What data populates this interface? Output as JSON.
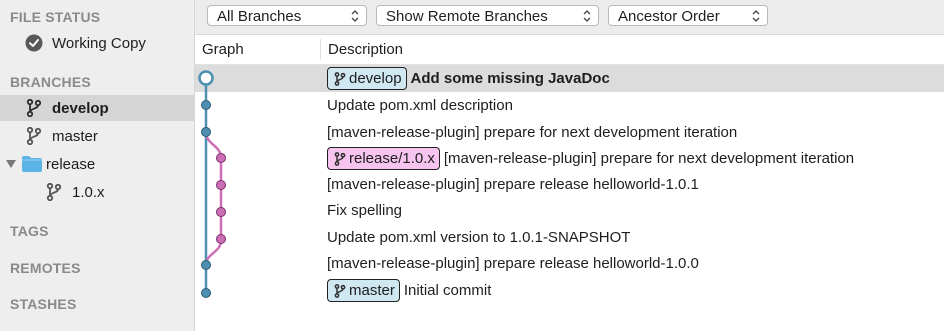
{
  "sidebar": {
    "file_status": "FILE STATUS",
    "working_copy": "Working Copy",
    "branches": "BRANCHES",
    "branch_items": [
      "develop",
      "master"
    ],
    "release_folder": "release",
    "release_child": "1.0.x",
    "tags": "TAGS",
    "remotes": "REMOTES",
    "stashes": "STASHES"
  },
  "toolbar": {
    "branches_filter": "All Branches",
    "remote_filter": "Show Remote Branches",
    "order": "Ancestor Order"
  },
  "table": {
    "col_graph": "Graph",
    "col_desc": "Description",
    "rows": [
      {
        "ref": "develop",
        "desc": "Add some missing JavaDoc"
      },
      {
        "desc": "Update pom.xml description"
      },
      {
        "desc": "[maven-release-plugin] prepare for next development iteration"
      },
      {
        "ref": "release/1.0.x",
        "desc": "[maven-release-plugin] prepare for next development iteration"
      },
      {
        "desc": "[maven-release-plugin] prepare release helloworld-1.0.1"
      },
      {
        "desc": "Fix spelling"
      },
      {
        "desc": "Update pom.xml version to 1.0.1-SNAPSHOT"
      },
      {
        "desc": "[maven-release-plugin] prepare release helloworld-1.0.0"
      },
      {
        "ref": "master",
        "desc": "Initial commit"
      }
    ]
  },
  "colors": {
    "main_line": "#4d8fb0",
    "release_line": "#cc6fb5",
    "blue_badge": "#cfe8f2",
    "pink_badge": "#f6c4ee"
  },
  "icons": [
    "check-circle-icon",
    "branch-icon",
    "folder-icon",
    "disclosure-triangle-icon",
    "chevron-updown-icon"
  ]
}
